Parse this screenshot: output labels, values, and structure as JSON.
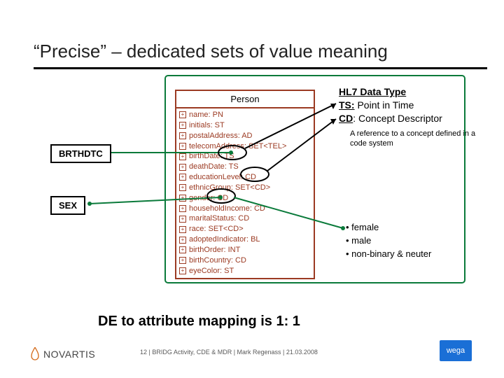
{
  "title": "“Precise” – dedicated sets of value meaning",
  "sideLabels": {
    "brthdtc": "BRTHDTC",
    "sex": "SEX"
  },
  "uml": {
    "header": "Person",
    "attrs": [
      "name: PN",
      "initials: ST",
      "postalAddress: AD",
      "telecomAddress: SET<TEL>",
      "birthDate: TS",
      "deathDate: TS",
      "educationLevel: CD",
      "ethnicGroup: SET<CD>",
      "gender: CD",
      "householdIncome: CD",
      "maritalStatus: CD",
      "race: SET<CD>",
      "adoptedIndicator: BL",
      "birthOrder: INT",
      "birthCountry: CD",
      "eyeColor: ST"
    ]
  },
  "hl7": {
    "title": "HL7 Data Type",
    "ts": "TS: Point in Time",
    "cd": "CD: Concept Descriptor",
    "sub": "A reference to a concept defined in a code system"
  },
  "values": {
    "v1": "female",
    "v2": "male",
    "v3": "non-binary & neuter"
  },
  "caption": "DE to attribute mapping is 1: 1",
  "footer": "12 | BRIDG Activity, CDE & MDR | Mark Regenass | 21.03.2008",
  "novartis": "NOVARTIS",
  "wega": "wega"
}
